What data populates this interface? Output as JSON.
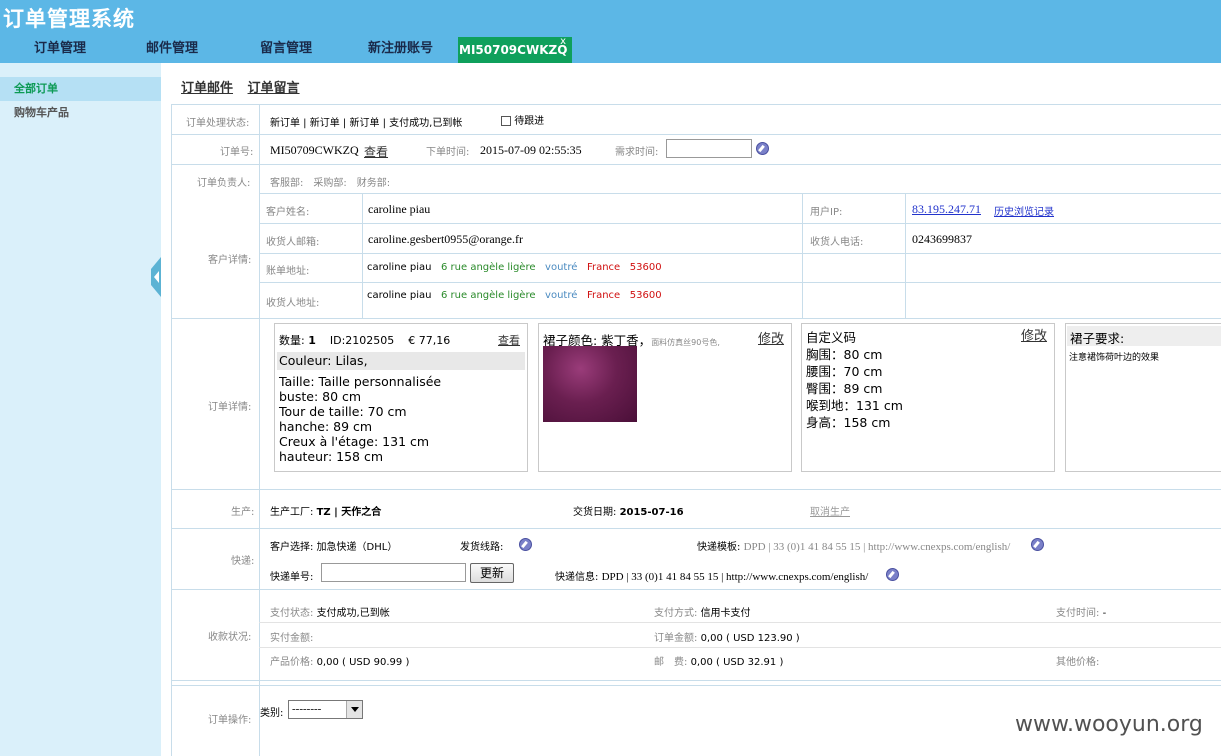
{
  "app": {
    "title": "订单管理系统"
  },
  "nav": {
    "tabs": [
      "订单管理",
      "邮件管理",
      "留言管理",
      "新注册账号"
    ],
    "active_tab": "MI50709CWKZQ",
    "close": "x"
  },
  "sidebar": {
    "items": [
      "全部订单",
      "购物车产品"
    ]
  },
  "subtabs": [
    "订单邮件",
    "订单留言"
  ],
  "order": {
    "status_label": "订单处理状态:",
    "status_value": "新订单 | 新订单 | 新订单 | 支付成功,已到帐",
    "follow_label": "待跟进",
    "number_label": "订单号:",
    "number_value": "MI50709CWKZQ",
    "view_link": "查看",
    "time_label": "下单时间:",
    "time_value": "2015-07-09 02:55:35",
    "need_time_label": "需求时间:",
    "owner_label": "订单负责人:",
    "owner_depts": "客服部:　采购部:　财务部:"
  },
  "customer": {
    "section_label": "客户详情:",
    "name_label": "客户姓名:",
    "name": "caroline piau",
    "email_label": "收货人邮箱:",
    "email": "caroline.gesbert0955@orange.fr",
    "bill_label": "账单地址:",
    "ship_label": "收货人地址:",
    "addr_name": "caroline piau",
    "addr_street": "6 rue angèle ligère",
    "addr_city": "voutré",
    "addr_country": "France",
    "addr_zip": "53600",
    "ip_label": "用户IP:",
    "ip": "83.195.247.71",
    "history_link": "历史浏览记录",
    "phone_label": "收货人电话:",
    "phone": "0243699837"
  },
  "details": {
    "section_label": "订单详情:",
    "qty_label": "数量:",
    "qty": "1",
    "id": "ID:2102505",
    "price": "€ 77,16",
    "view_link": "查看",
    "lines": [
      "Couleur: Lilas,",
      "Taille: Taille personnalisée",
      "buste: 80 cm",
      "Tour de taille: 70 cm",
      "hanche: 89 cm",
      "Creux à l'étage: 131 cm",
      "hauteur: 158 cm"
    ],
    "color_label": "裙子颜色: 紫丁香，",
    "color_note": "面料仿真丝90号色,",
    "edit_link": "修改",
    "custom_title": "自定义码",
    "custom_edit": "修改",
    "custom_lines": [
      "胸围：80 cm",
      "腰围：70 cm",
      "臀围：89 cm",
      "喉到地：131 cm",
      "身高：158 cm"
    ],
    "req_title": "裙子要求:",
    "req_text": "注意裙饰荷叶边的效果"
  },
  "production": {
    "label": "生产:",
    "factory_label": "生产工厂:",
    "factory": "TZ | 天作之合",
    "date_label": "交货日期:",
    "date": "2015-07-16",
    "cancel_link": "取消生产"
  },
  "shipping": {
    "label": "快递:",
    "choice": "客户选择: 加急快递（DHL）",
    "route_label": "发货线路:",
    "template_label": "快递模板:",
    "template": "DPD | 33 (0)1 41 84 55 15 | http://www.cnexps.com/english/",
    "tracking_label": "快递单号:",
    "update_btn": "更新",
    "info_label": "快递信息:",
    "info": "DPD | 33 (0)1 41 84 55 15 | http://www.cnexps.com/english/"
  },
  "payment": {
    "label": "收款状况:",
    "status_label": "支付状态:",
    "status": "支付成功,已到帐",
    "method_label": "支付方式:",
    "method": "信用卡支付",
    "time_label": "支付时间:",
    "time": "-",
    "paid_label": "实付金额:",
    "paid": "",
    "order_amount_label": "订单金额:",
    "order_amount": "0,00 ( USD 123.90 )",
    "product_label": "产品价格:",
    "product": "0,00 ( USD 90.99 )",
    "postage_label": "邮　费:",
    "postage": "0,00 ( USD 32.91 )",
    "other_label": "其他价格:",
    "other": ""
  },
  "operation": {
    "label": "订单操作:",
    "type_label": "类别:",
    "type_value": "--------"
  },
  "watermark": "www.wooyun.org"
}
